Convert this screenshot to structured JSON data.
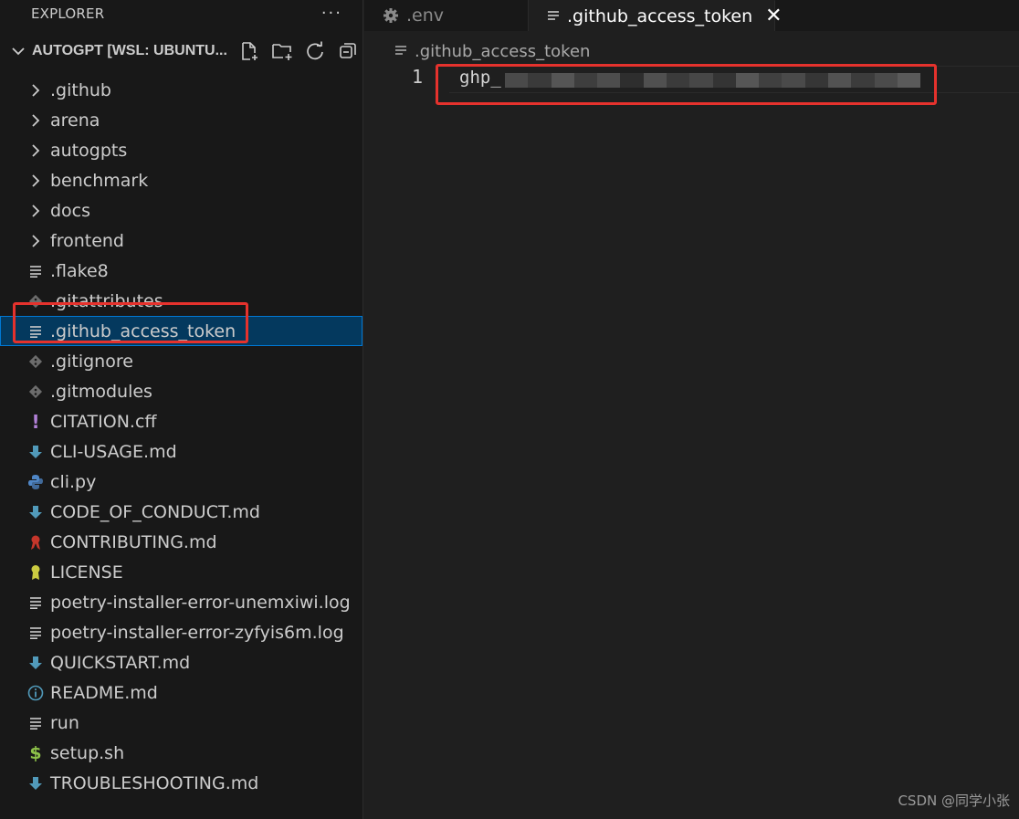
{
  "sidebar": {
    "title": "EXPLORER",
    "more": "···",
    "section_title": "AUTOGPT [WSL: UBUNTU...",
    "items": [
      {
        "label": ".github",
        "icon": "chevron-right-icon",
        "type": "folder"
      },
      {
        "label": "arena",
        "icon": "chevron-right-icon",
        "type": "folder"
      },
      {
        "label": "autogpts",
        "icon": "chevron-right-icon",
        "type": "folder"
      },
      {
        "label": "benchmark",
        "icon": "chevron-right-icon",
        "type": "folder"
      },
      {
        "label": "docs",
        "icon": "chevron-right-icon",
        "type": "folder"
      },
      {
        "label": "frontend",
        "icon": "chevron-right-icon",
        "type": "folder"
      },
      {
        "label": ".flake8",
        "icon": "lines-icon",
        "type": "file"
      },
      {
        "label": ".gitattributes",
        "icon": "git-icon",
        "type": "file"
      },
      {
        "label": ".github_access_token",
        "icon": "lines-icon",
        "type": "file",
        "selected": true
      },
      {
        "label": ".gitignore",
        "icon": "git-icon",
        "type": "file"
      },
      {
        "label": ".gitmodules",
        "icon": "git-icon",
        "type": "file"
      },
      {
        "label": "CITATION.cff",
        "icon": "exclamation-icon",
        "type": "file"
      },
      {
        "label": "CLI-USAGE.md",
        "icon": "markdown-arrow-icon",
        "type": "file"
      },
      {
        "label": "cli.py",
        "icon": "python-icon",
        "type": "file"
      },
      {
        "label": "CODE_OF_CONDUCT.md",
        "icon": "markdown-arrow-icon",
        "type": "file"
      },
      {
        "label": "CONTRIBUTING.md",
        "icon": "ribbon-icon",
        "type": "file"
      },
      {
        "label": "LICENSE",
        "icon": "license-icon",
        "type": "file"
      },
      {
        "label": "poetry-installer-error-unemxiwi.log",
        "icon": "lines-icon",
        "type": "file"
      },
      {
        "label": "poetry-installer-error-zyfyis6m.log",
        "icon": "lines-icon",
        "type": "file"
      },
      {
        "label": "QUICKSTART.md",
        "icon": "markdown-arrow-icon",
        "type": "file"
      },
      {
        "label": "README.md",
        "icon": "info-icon",
        "type": "file"
      },
      {
        "label": "run",
        "icon": "lines-icon",
        "type": "file"
      },
      {
        "label": "setup.sh",
        "icon": "dollar-icon",
        "type": "file"
      },
      {
        "label": "TROUBLESHOOTING.md",
        "icon": "markdown-arrow-icon",
        "type": "file"
      }
    ]
  },
  "tabs": [
    {
      "label": ".env",
      "icon": "gear-icon",
      "active": false
    },
    {
      "label": ".github_access_token",
      "icon": "lines-icon",
      "active": true,
      "close": "✕"
    }
  ],
  "breadcrumb": ".github_access_token",
  "editor": {
    "line_number": "1",
    "code_visible": "ghp_"
  },
  "watermark": "CSDN @同学小张",
  "colors": {
    "highlight_box": "#e5322d",
    "selection_bg": "#04395e",
    "selection_border": "#0078d4"
  }
}
